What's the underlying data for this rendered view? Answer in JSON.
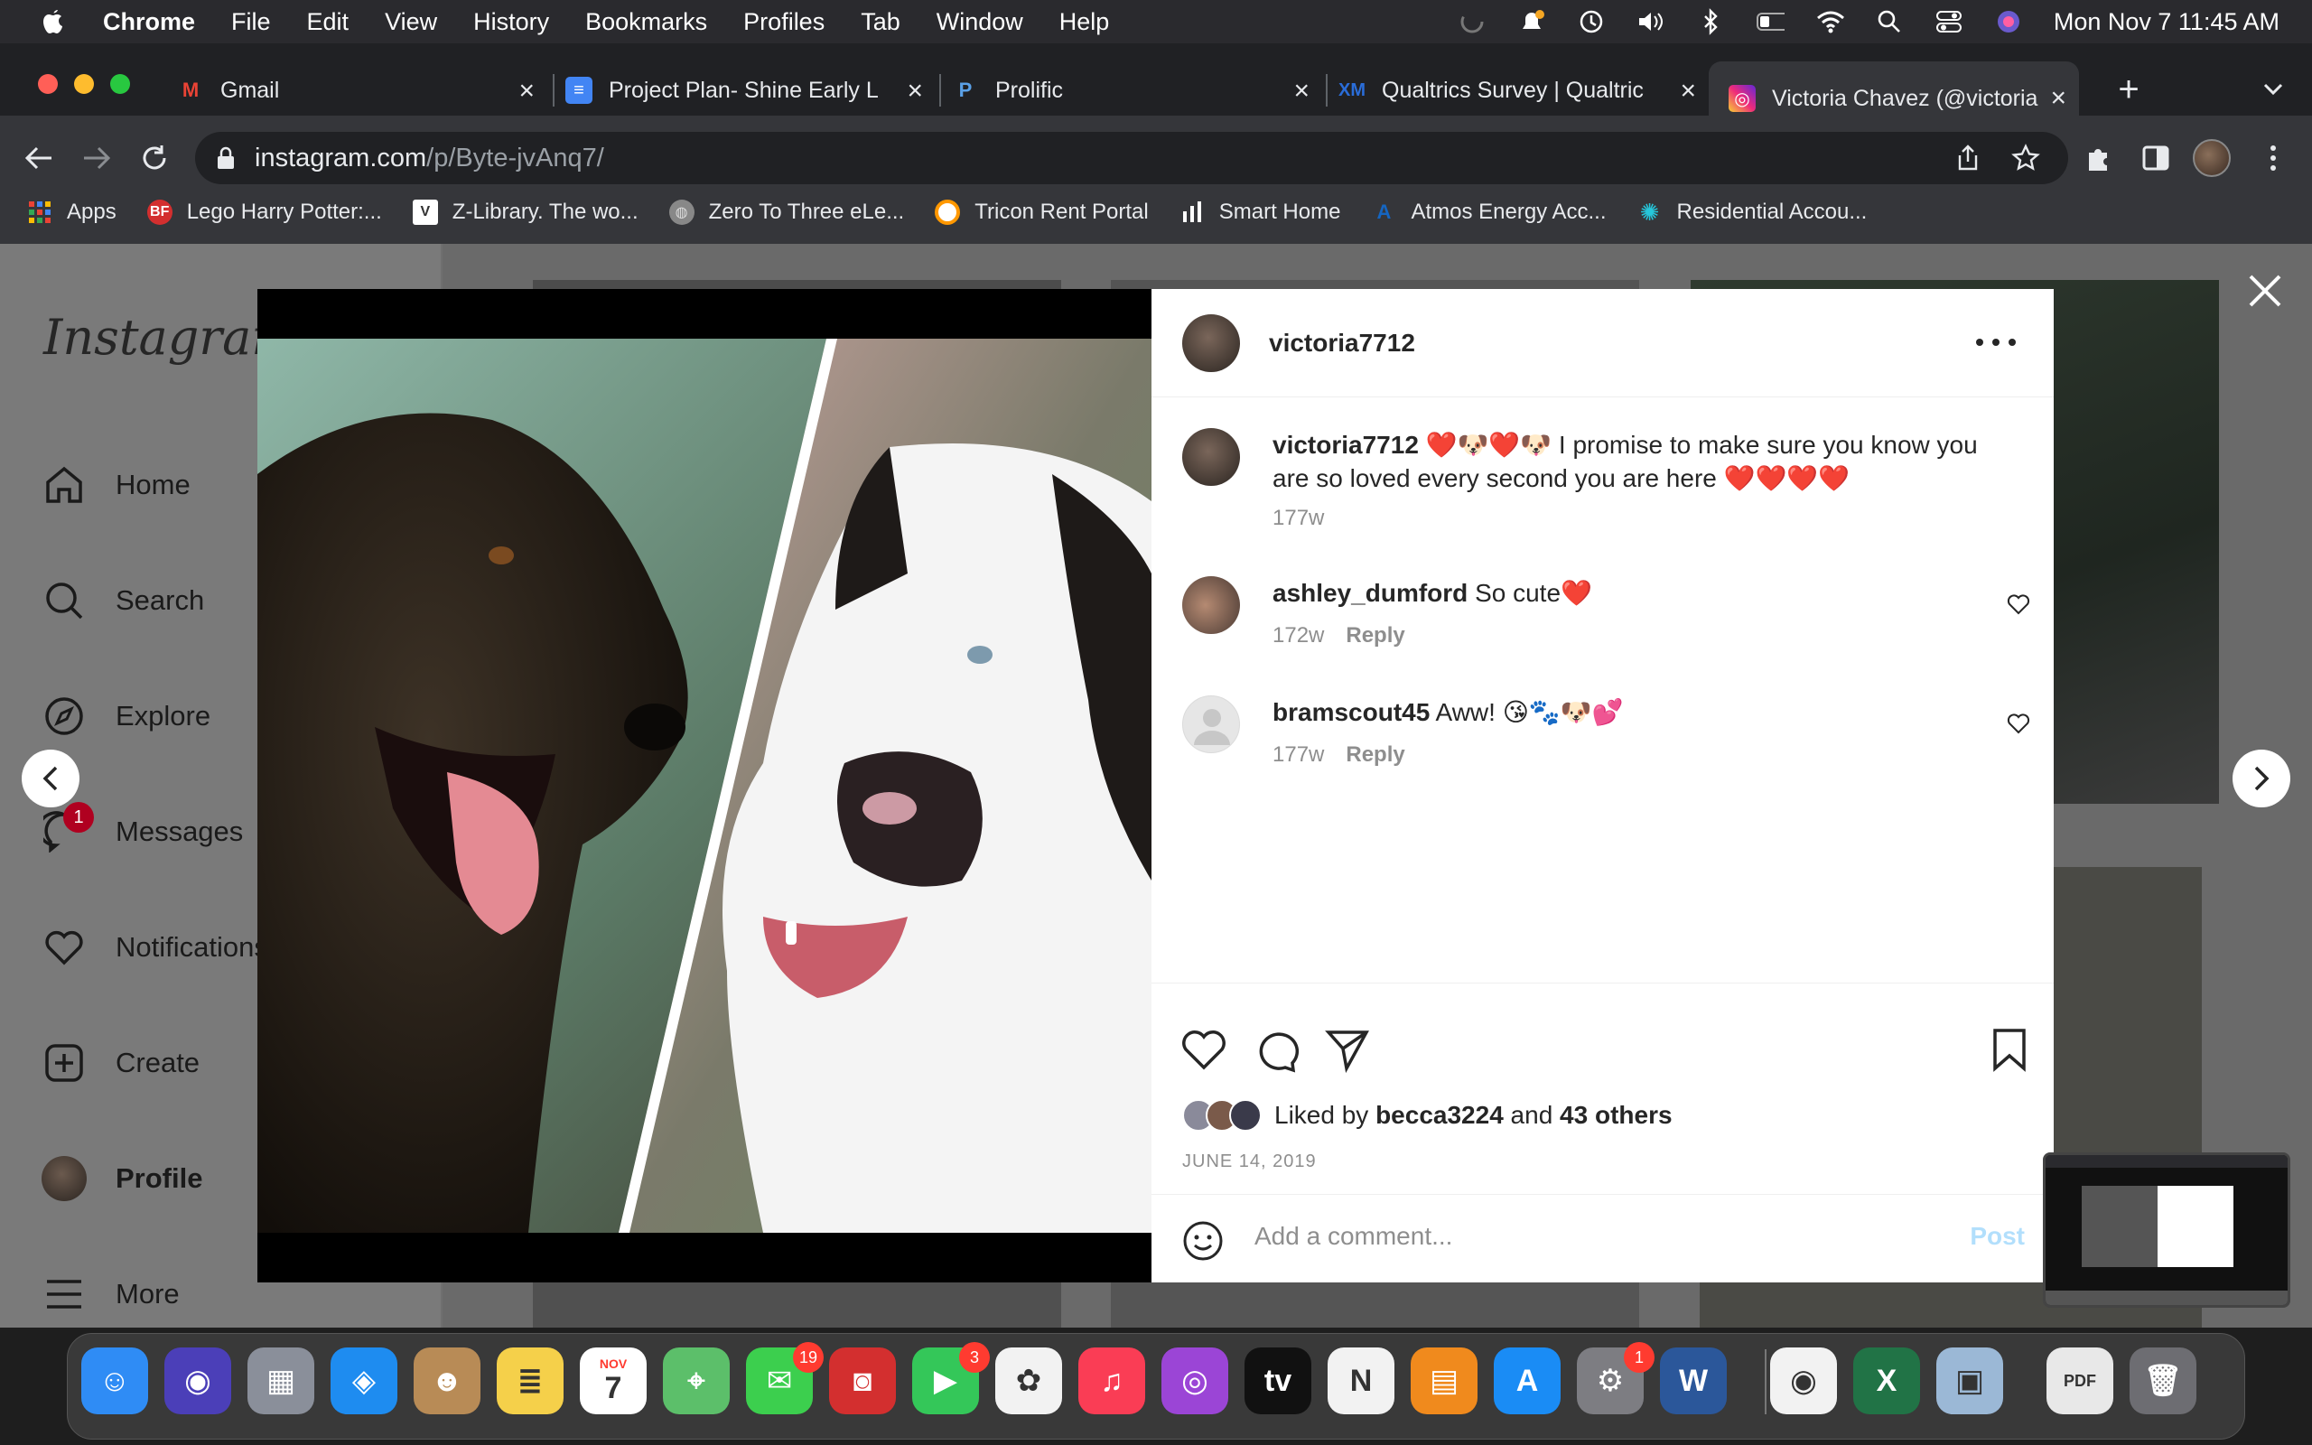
{
  "menubar": {
    "app_name": "Chrome",
    "items": [
      "File",
      "Edit",
      "View",
      "History",
      "Bookmarks",
      "Profiles",
      "Tab",
      "Window",
      "Help"
    ],
    "clock": "Mon Nov 7  11:45 AM"
  },
  "tabs": [
    {
      "title": "Gmail",
      "favicon": "gmail-icon",
      "fav_label": "M",
      "fav_color": "#ea4335"
    },
    {
      "title": "Project Plan- Shine Early L",
      "favicon": "docs-icon",
      "fav_label": "≡",
      "fav_color": "#4285f4"
    },
    {
      "title": "Prolific",
      "favicon": "prolific-icon",
      "fav_label": "P",
      "fav_color": "#5aa0e6"
    },
    {
      "title": "Qualtrics Survey | Qualtric",
      "favicon": "qualtrics-icon",
      "fav_label": "XM",
      "fav_color": "#2a6dd9"
    },
    {
      "title": "Victoria Chavez (@victoria",
      "favicon": "instagram-icon",
      "fav_label": "◎",
      "fav_color": "#e1306c"
    }
  ],
  "new_tab_label": "+",
  "address": {
    "host": "instagram.com",
    "path": "/p/Byte-jvAnq7/"
  },
  "bookmarks": [
    {
      "label": "Apps",
      "icon": "apps-grid-icon",
      "color": "#ea4335",
      "glyph": "⋮"
    },
    {
      "label": "Lego Harry Potter:...",
      "icon": "bf-icon",
      "color": "#d32f2f",
      "glyph": "BF"
    },
    {
      "label": "Z-Library. The wo...",
      "icon": "zlibrary-icon",
      "color": "#ffffff",
      "glyph": "V"
    },
    {
      "label": "Zero To Three eLe...",
      "icon": "globe-icon",
      "color": "#888888",
      "glyph": "◍"
    },
    {
      "label": "Tricon Rent Portal",
      "icon": "tricon-icon",
      "color": "#ff9800",
      "glyph": "◎"
    },
    {
      "label": "Smart Home",
      "icon": "bars-icon",
      "color": "#ffffff",
      "glyph": "▮"
    },
    {
      "label": "Atmos Energy Acc...",
      "icon": "atmos-icon",
      "color": "#1565c0",
      "glyph": "A"
    },
    {
      "label": "Residential Accou...",
      "icon": "starburst-icon",
      "color": "#26c6da",
      "glyph": "✺"
    }
  ],
  "instagram": {
    "logo": "Instagram",
    "nav": [
      {
        "label": "Home",
        "icon": "home-icon"
      },
      {
        "label": "Search",
        "icon": "search-icon"
      },
      {
        "label": "Explore",
        "icon": "compass-icon"
      },
      {
        "label": "Messages",
        "icon": "messenger-icon",
        "badge": "1"
      },
      {
        "label": "Notifications",
        "icon": "heart-icon"
      },
      {
        "label": "Create",
        "icon": "plus-square-icon"
      },
      {
        "label": "Profile",
        "icon": "profile-avatar"
      },
      {
        "label": "More",
        "icon": "menu-icon"
      }
    ]
  },
  "post": {
    "author": "victoria7712",
    "caption_author": "victoria7712",
    "caption": "❤️🐶❤️🐶 I promise to make sure you know you are so loved every second you are here ❤️❤️❤️❤️",
    "caption_age": "177w",
    "comments": [
      {
        "user": "ashley_dumford",
        "text": "So cute❤️",
        "age": "172w",
        "reply": "Reply"
      },
      {
        "user": "bramscout45",
        "text": "Aww! 😘🐾🐶💕",
        "age": "177w",
        "reply": "Reply"
      }
    ],
    "liked_by_prefix": "Liked by",
    "liked_by_user": "becca3224",
    "liked_by_and": "and",
    "liked_by_others": "43 others",
    "date": "JUNE 14, 2019",
    "comment_placeholder": "Add a comment...",
    "post_button": "Post"
  },
  "dock": [
    {
      "name": "finder",
      "color": "#2f8cf5",
      "glyph": "☺"
    },
    {
      "name": "siri",
      "color": "#4b3fb8",
      "glyph": "◉"
    },
    {
      "name": "launchpad",
      "color": "#8a8f9a",
      "glyph": "▦"
    },
    {
      "name": "safari",
      "color": "#1e8cf0",
      "glyph": "◈"
    },
    {
      "name": "contacts",
      "color": "#b88b56",
      "glyph": "☻"
    },
    {
      "name": "notes",
      "color": "#f5d04a",
      "glyph": "≣"
    },
    {
      "name": "calendar",
      "color": "#ffffff",
      "glyph": "7",
      "sublabel": "NOV"
    },
    {
      "name": "maps",
      "color": "#5cbf6a",
      "glyph": "⌖"
    },
    {
      "name": "messages",
      "color": "#3ccf4e",
      "glyph": "✉",
      "badge": "19"
    },
    {
      "name": "photo-booth",
      "color": "#d32f2f",
      "glyph": "◙"
    },
    {
      "name": "facetime",
      "color": "#34c759",
      "glyph": "▶",
      "badge": "3"
    },
    {
      "name": "photos",
      "color": "#f2f2f2",
      "glyph": "✿"
    },
    {
      "name": "music",
      "color": "#fa3d55",
      "glyph": "♫"
    },
    {
      "name": "podcasts",
      "color": "#9b45d6",
      "glyph": "◎"
    },
    {
      "name": "apple-tv",
      "color": "#111111",
      "glyph": "tv"
    },
    {
      "name": "news",
      "color": "#f2f2f2",
      "glyph": "N"
    },
    {
      "name": "books",
      "color": "#f08a1d",
      "glyph": "▤"
    },
    {
      "name": "app-store",
      "color": "#1a8cf5",
      "glyph": "A"
    },
    {
      "name": "system-preferences",
      "color": "#7d7d82",
      "glyph": "⚙",
      "badge": "1"
    },
    {
      "name": "word",
      "color": "#2b579a",
      "glyph": "W"
    },
    {
      "name": "chrome",
      "color": "#f2f2f2",
      "glyph": "◉"
    },
    {
      "name": "excel",
      "color": "#217346",
      "glyph": "X"
    },
    {
      "name": "preview",
      "color": "#9bb8d6",
      "glyph": "▣"
    },
    {
      "name": "pdf-document",
      "color": "#e8e8e8",
      "glyph": "PDF"
    },
    {
      "name": "trash",
      "color": "#6d6d72",
      "glyph": "🗑"
    }
  ]
}
